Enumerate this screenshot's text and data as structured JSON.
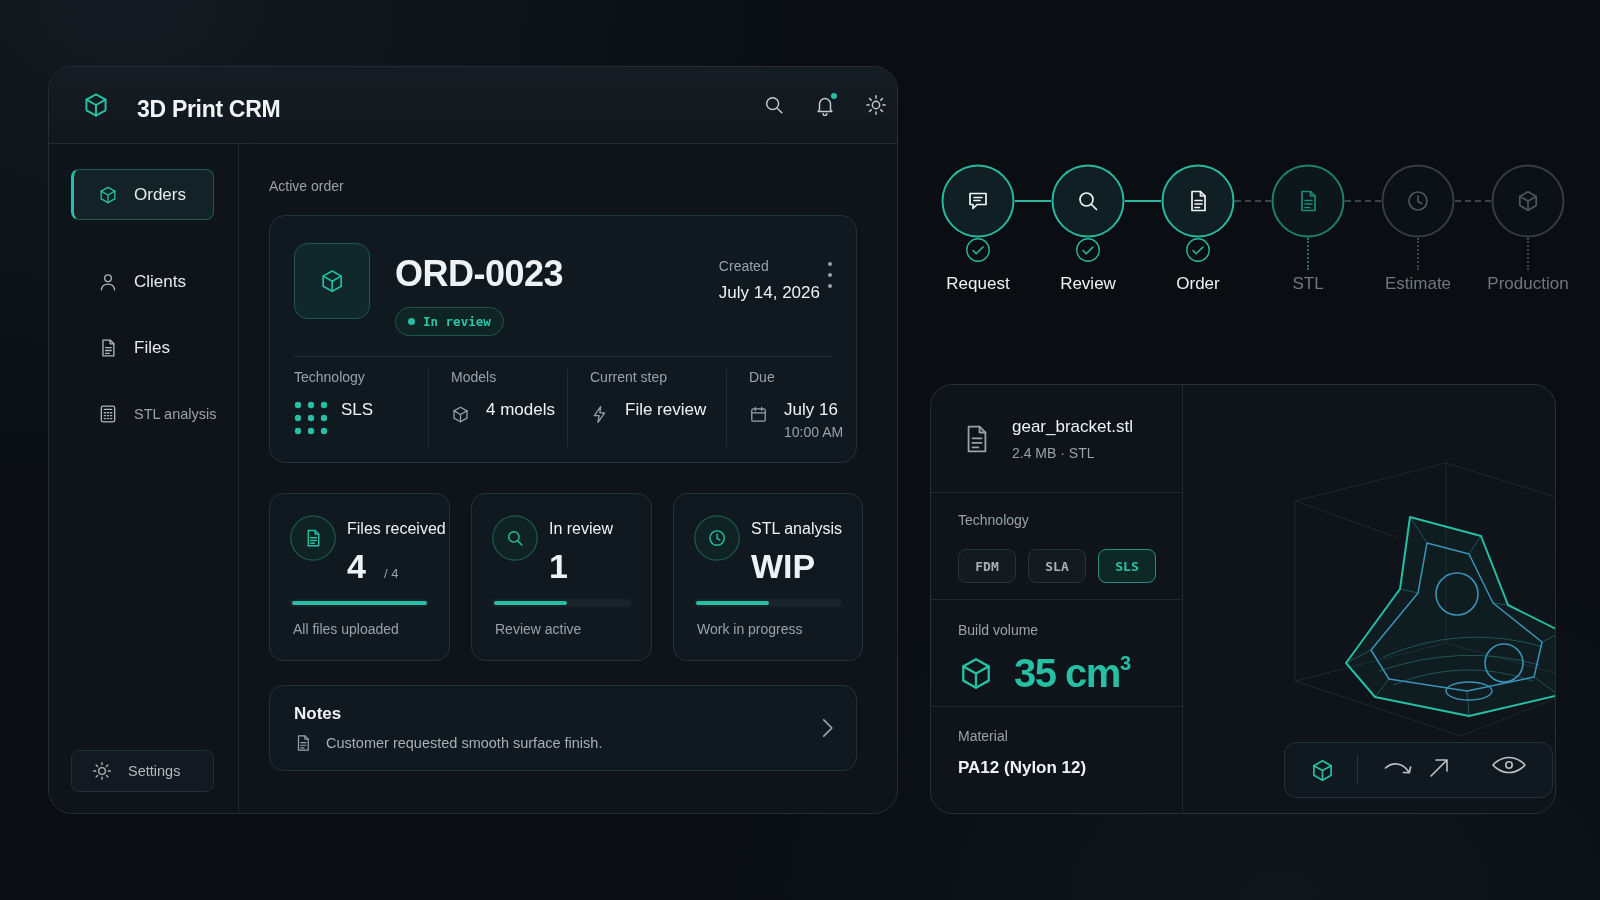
{
  "app": {
    "title": "3D Print CRM",
    "notifications": true
  },
  "sidebar": {
    "items": [
      {
        "label": "Orders",
        "selected": true,
        "disabled": false
      },
      {
        "label": "Clients",
        "selected": false,
        "disabled": false
      },
      {
        "label": "Files",
        "selected": false,
        "disabled": false
      },
      {
        "label": "STL analysis",
        "selected": false,
        "disabled": true
      }
    ],
    "settings": {
      "label": "Settings"
    }
  },
  "active_order": {
    "section_label": "Active order",
    "id": "ORD-0023",
    "status": "In review",
    "created_label": "Created",
    "created_date": "July 14, 2026",
    "details": [
      {
        "label": "Technology",
        "value": "SLS"
      },
      {
        "label": "Models",
        "value": "4 models"
      },
      {
        "label": "Current step",
        "value": "File review"
      },
      {
        "label": "Due",
        "value": "July 16",
        "sub": "10:00 AM"
      }
    ]
  },
  "stats": [
    {
      "title": "Files received",
      "value": "4",
      "total": "/ 4",
      "level": 1,
      "caption": "All files uploaded"
    },
    {
      "title": "In review",
      "value": "1",
      "level": 0.54,
      "caption": "Review active"
    },
    {
      "title": "STL analysis",
      "value": "WIP",
      "level": 0.51,
      "caption": "Work in progress"
    }
  ],
  "notes": {
    "title": "Notes",
    "text": "Customer requested smooth surface finish."
  },
  "steps": [
    {
      "label": "Request",
      "done": true,
      "current": false
    },
    {
      "label": "Review",
      "done": true,
      "current": false
    },
    {
      "label": "Order",
      "done": true,
      "current": false
    },
    {
      "label": "STL",
      "done": false,
      "current": true
    },
    {
      "label": "Estimate",
      "done": false,
      "current": false
    },
    {
      "label": "Production",
      "done": false,
      "current": false
    }
  ],
  "file": {
    "name": "gear_bracket.stl",
    "meta": "2.4 MB · STL",
    "technology_label": "Technology",
    "technologies": [
      {
        "label": "FDM",
        "selected": false
      },
      {
        "label": "SLA",
        "selected": false
      },
      {
        "label": "SLS",
        "selected": true
      }
    ],
    "volume_label": "Build volume",
    "volume": "35 cm$^{3}$",
    "material_label": "Material",
    "material": "PA12 (Nylon 12)",
    "viewer_tools": [
      {
        "selected": true
      },
      {
        "selected": false
      },
      {
        "selected": false
      },
      {
        "selected": false
      }
    ]
  }
}
